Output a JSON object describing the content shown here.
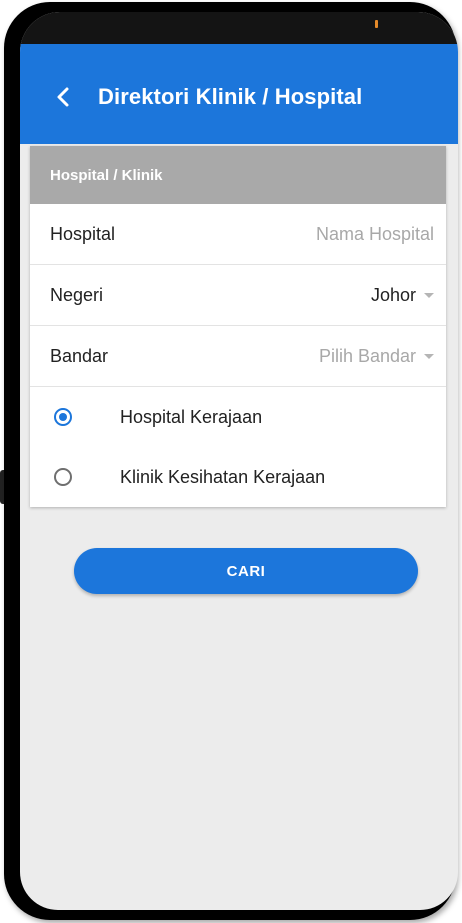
{
  "app_bar": {
    "title": "Direktori Klinik / Hospital",
    "back_icon": "chevron-left-icon"
  },
  "form": {
    "section_header": "Hospital / Klinik",
    "hospital": {
      "label": "Hospital",
      "placeholder": "Nama Hospital"
    },
    "negeri": {
      "label": "Negeri",
      "selected": "Johor"
    },
    "bandar": {
      "label": "Bandar",
      "placeholder": "Pilih Bandar"
    },
    "types": [
      {
        "label": "Hospital Kerajaan",
        "selected": true
      },
      {
        "label": "Klinik Kesihatan Kerajaan",
        "selected": false
      }
    ]
  },
  "search_button": {
    "label": "CARI"
  },
  "colors": {
    "primary": "#1c76db",
    "header_gray": "#a9a9a9",
    "background": "#ececec"
  }
}
